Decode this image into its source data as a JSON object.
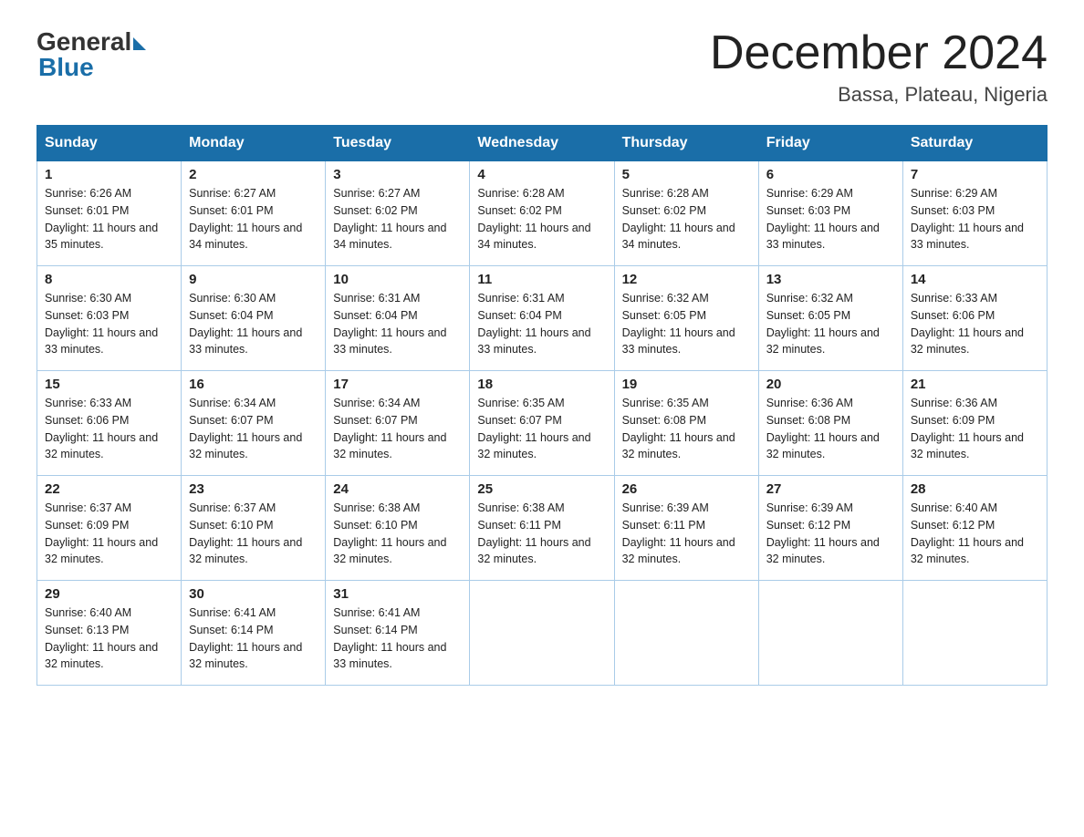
{
  "logo": {
    "general": "General",
    "blue": "Blue"
  },
  "title": "December 2024",
  "location": "Bassa, Plateau, Nigeria",
  "days_of_week": [
    "Sunday",
    "Monday",
    "Tuesday",
    "Wednesday",
    "Thursday",
    "Friday",
    "Saturday"
  ],
  "weeks": [
    [
      {
        "day": "1",
        "sunrise": "6:26 AM",
        "sunset": "6:01 PM",
        "daylight": "11 hours and 35 minutes."
      },
      {
        "day": "2",
        "sunrise": "6:27 AM",
        "sunset": "6:01 PM",
        "daylight": "11 hours and 34 minutes."
      },
      {
        "day": "3",
        "sunrise": "6:27 AM",
        "sunset": "6:02 PM",
        "daylight": "11 hours and 34 minutes."
      },
      {
        "day": "4",
        "sunrise": "6:28 AM",
        "sunset": "6:02 PM",
        "daylight": "11 hours and 34 minutes."
      },
      {
        "day": "5",
        "sunrise": "6:28 AM",
        "sunset": "6:02 PM",
        "daylight": "11 hours and 34 minutes."
      },
      {
        "day": "6",
        "sunrise": "6:29 AM",
        "sunset": "6:03 PM",
        "daylight": "11 hours and 33 minutes."
      },
      {
        "day": "7",
        "sunrise": "6:29 AM",
        "sunset": "6:03 PM",
        "daylight": "11 hours and 33 minutes."
      }
    ],
    [
      {
        "day": "8",
        "sunrise": "6:30 AM",
        "sunset": "6:03 PM",
        "daylight": "11 hours and 33 minutes."
      },
      {
        "day": "9",
        "sunrise": "6:30 AM",
        "sunset": "6:04 PM",
        "daylight": "11 hours and 33 minutes."
      },
      {
        "day": "10",
        "sunrise": "6:31 AM",
        "sunset": "6:04 PM",
        "daylight": "11 hours and 33 minutes."
      },
      {
        "day": "11",
        "sunrise": "6:31 AM",
        "sunset": "6:04 PM",
        "daylight": "11 hours and 33 minutes."
      },
      {
        "day": "12",
        "sunrise": "6:32 AM",
        "sunset": "6:05 PM",
        "daylight": "11 hours and 33 minutes."
      },
      {
        "day": "13",
        "sunrise": "6:32 AM",
        "sunset": "6:05 PM",
        "daylight": "11 hours and 32 minutes."
      },
      {
        "day": "14",
        "sunrise": "6:33 AM",
        "sunset": "6:06 PM",
        "daylight": "11 hours and 32 minutes."
      }
    ],
    [
      {
        "day": "15",
        "sunrise": "6:33 AM",
        "sunset": "6:06 PM",
        "daylight": "11 hours and 32 minutes."
      },
      {
        "day": "16",
        "sunrise": "6:34 AM",
        "sunset": "6:07 PM",
        "daylight": "11 hours and 32 minutes."
      },
      {
        "day": "17",
        "sunrise": "6:34 AM",
        "sunset": "6:07 PM",
        "daylight": "11 hours and 32 minutes."
      },
      {
        "day": "18",
        "sunrise": "6:35 AM",
        "sunset": "6:07 PM",
        "daylight": "11 hours and 32 minutes."
      },
      {
        "day": "19",
        "sunrise": "6:35 AM",
        "sunset": "6:08 PM",
        "daylight": "11 hours and 32 minutes."
      },
      {
        "day": "20",
        "sunrise": "6:36 AM",
        "sunset": "6:08 PM",
        "daylight": "11 hours and 32 minutes."
      },
      {
        "day": "21",
        "sunrise": "6:36 AM",
        "sunset": "6:09 PM",
        "daylight": "11 hours and 32 minutes."
      }
    ],
    [
      {
        "day": "22",
        "sunrise": "6:37 AM",
        "sunset": "6:09 PM",
        "daylight": "11 hours and 32 minutes."
      },
      {
        "day": "23",
        "sunrise": "6:37 AM",
        "sunset": "6:10 PM",
        "daylight": "11 hours and 32 minutes."
      },
      {
        "day": "24",
        "sunrise": "6:38 AM",
        "sunset": "6:10 PM",
        "daylight": "11 hours and 32 minutes."
      },
      {
        "day": "25",
        "sunrise": "6:38 AM",
        "sunset": "6:11 PM",
        "daylight": "11 hours and 32 minutes."
      },
      {
        "day": "26",
        "sunrise": "6:39 AM",
        "sunset": "6:11 PM",
        "daylight": "11 hours and 32 minutes."
      },
      {
        "day": "27",
        "sunrise": "6:39 AM",
        "sunset": "6:12 PM",
        "daylight": "11 hours and 32 minutes."
      },
      {
        "day": "28",
        "sunrise": "6:40 AM",
        "sunset": "6:12 PM",
        "daylight": "11 hours and 32 minutes."
      }
    ],
    [
      {
        "day": "29",
        "sunrise": "6:40 AM",
        "sunset": "6:13 PM",
        "daylight": "11 hours and 32 minutes."
      },
      {
        "day": "30",
        "sunrise": "6:41 AM",
        "sunset": "6:14 PM",
        "daylight": "11 hours and 32 minutes."
      },
      {
        "day": "31",
        "sunrise": "6:41 AM",
        "sunset": "6:14 PM",
        "daylight": "11 hours and 33 minutes."
      },
      null,
      null,
      null,
      null
    ]
  ]
}
